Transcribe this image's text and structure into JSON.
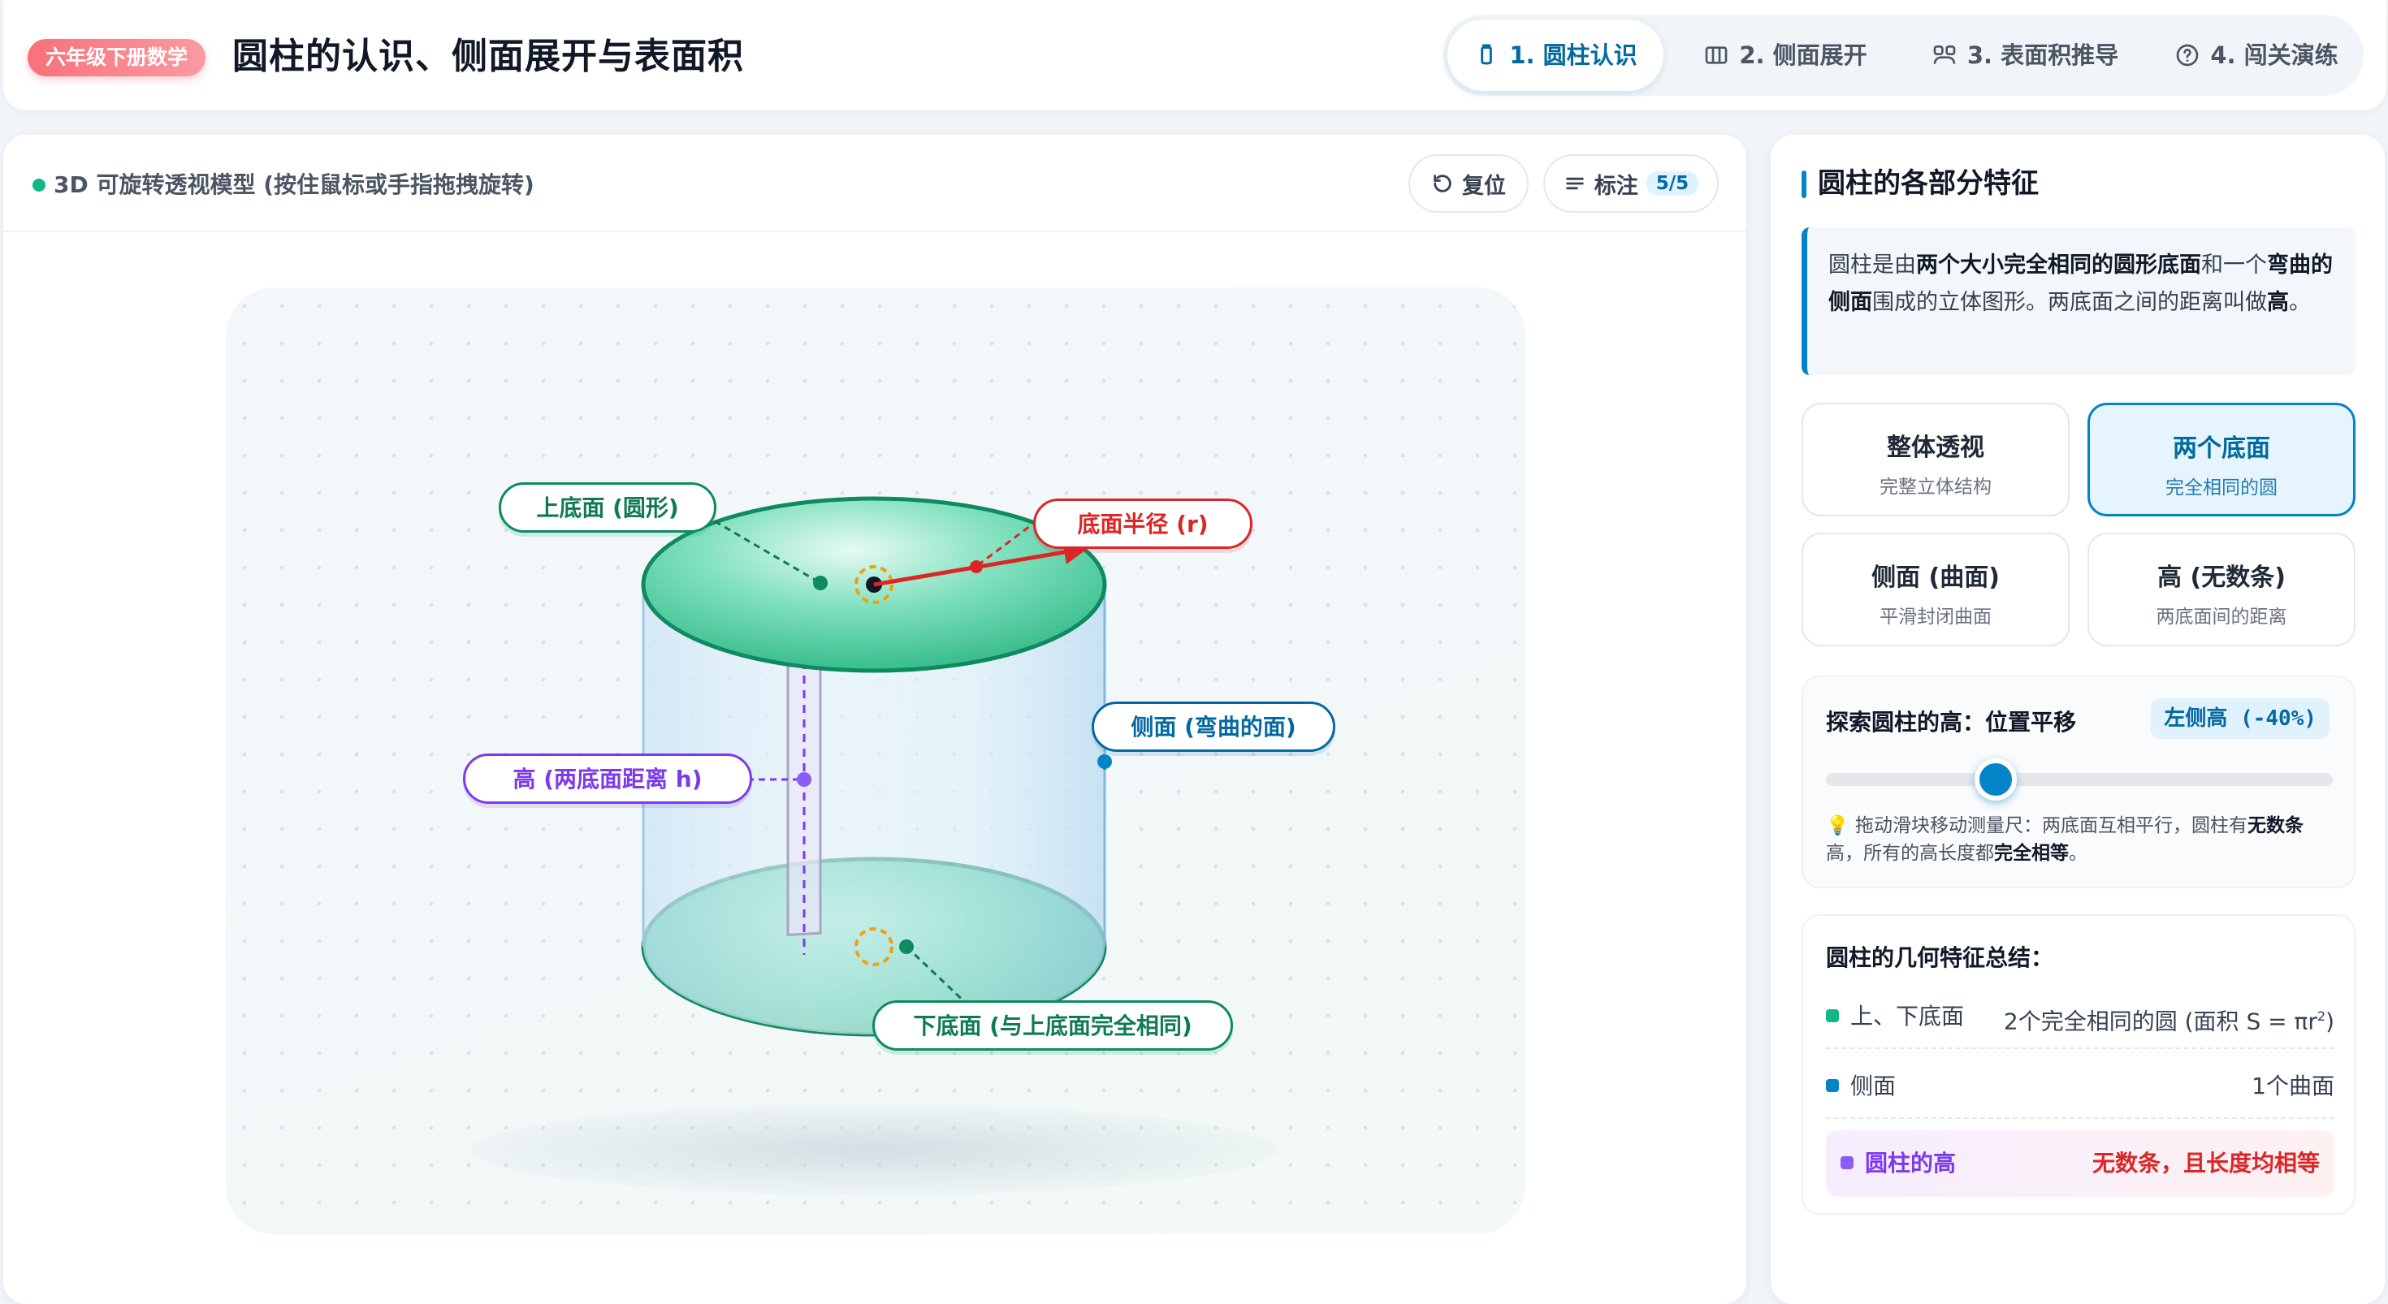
{
  "header": {
    "grade_badge": "六年级下册数学",
    "title": "圆柱的认识、侧面展开与表面积",
    "tabs": [
      {
        "label": "1. 圆柱认识",
        "icon": "cylinder-icon",
        "active": true
      },
      {
        "label": "2. 侧面展开",
        "icon": "columns-icon",
        "active": false
      },
      {
        "label": "3. 表面积推导",
        "icon": "grid-icon",
        "active": false
      },
      {
        "label": "4. 闯关演练",
        "icon": "help-circle-icon",
        "active": false
      }
    ]
  },
  "model": {
    "title": "3D 可旋转透视模型 (按住鼠标或手指拖拽旋转)",
    "reset_label": "复位",
    "labels_label": "标注",
    "labels_count": "5/5",
    "tags": {
      "top_base": "上底面 (圆形)",
      "radius": "底面半径 (r)",
      "side": "侧面 (弯曲的面)",
      "height": "高 (两底面距离 h)",
      "bottom_base": "下底面 (与上底面完全相同)"
    }
  },
  "panel": {
    "title": "圆柱的各部分特征",
    "intro": {
      "p1": "圆柱是由",
      "b1": "两个大小完全相同的圆形底面",
      "p2": "和一个",
      "b2": "弯曲的侧面",
      "p3": "围成的立体图形。两底面之间的距离叫做",
      "b3": "高",
      "p4": "。"
    },
    "options": [
      {
        "title": "整体透视",
        "sub": "完整立体结构",
        "active": false
      },
      {
        "title": "两个底面",
        "sub": "完全相同的圆",
        "active": true
      },
      {
        "title": "侧面 (曲面)",
        "sub": "平滑封闭曲面",
        "active": false
      },
      {
        "title": "高 (无数条)",
        "sub": "两底面间的距离",
        "active": false
      }
    ],
    "explore": {
      "label": "探索圆柱的高：位置平移",
      "badge": "左侧高 (-40%)",
      "slider_value": 0.32,
      "hint_icon": "💡",
      "hint_p1": "拖动滑块移动测量尺：两底面互相平行，圆柱有",
      "hint_b1": "无数条",
      "hint_p2": "高，所有的高长度都",
      "hint_b2": "完全相等",
      "hint_p3": "。"
    },
    "summary": {
      "title": "圆柱的几何特征总结：",
      "rows": [
        {
          "name": "上、下底面",
          "value": "2个完全相同的圆 (面积 S = πr",
          "sup": "2",
          "value_end": ")",
          "color": "#10b981"
        },
        {
          "name": "侧面",
          "value": "1个曲面",
          "color": "#0284c7"
        },
        {
          "name": "圆柱的高",
          "value": "无数条，且长度均相等",
          "color": "#8b5cf6"
        }
      ]
    }
  },
  "colors": {
    "accent": "#0284c7",
    "green": "#10b981",
    "red": "#dc2626",
    "purple": "#7c3aed",
    "badge": "#f8717a"
  }
}
